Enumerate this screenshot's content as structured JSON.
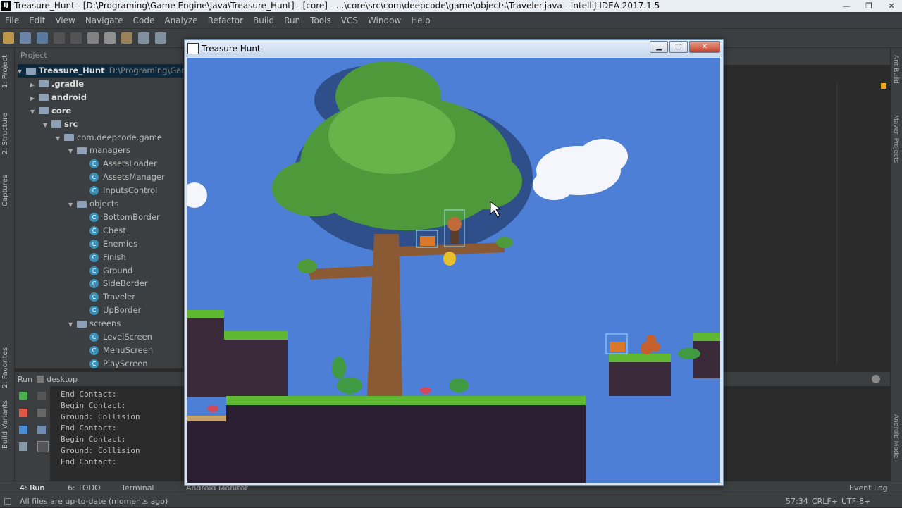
{
  "window": {
    "title": "Treasure_Hunt - [D:\\Programing\\Game Engine\\Java\\Treasure_Hunt] - [core] - ...\\core\\src\\com\\deepcode\\game\\objects\\Traveler.java - IntelliJ IDEA 2017.1.5",
    "app_icon_text": "IJ"
  },
  "menu": [
    "File",
    "Edit",
    "View",
    "Navigate",
    "Code",
    "Analyze",
    "Refactor",
    "Build",
    "Run",
    "Tools",
    "VCS",
    "Window",
    "Help"
  ],
  "toolbar": {
    "config_label": "desktop"
  },
  "left_tabs": [
    "1: Project",
    "2: Structure",
    "Captures",
    "Build Variants",
    "2: Favorites"
  ],
  "right_tabs": [
    "Ant Build",
    "Maven Projects",
    "Android Model"
  ],
  "project": {
    "header": "Project",
    "tree": [
      {
        "label": "Treasure_Hunt",
        "path": "D:\\Programing\\Game E",
        "depth": 0,
        "kind": "module",
        "open": true
      },
      {
        "label": ".gradle",
        "depth": 1,
        "kind": "folder",
        "open": false
      },
      {
        "label": "android",
        "depth": 1,
        "kind": "folder",
        "open": false
      },
      {
        "label": "core",
        "depth": 1,
        "kind": "folder",
        "open": true
      },
      {
        "label": "src",
        "depth": 2,
        "kind": "folder",
        "open": true
      },
      {
        "label": "com.deepcode.game",
        "depth": 3,
        "kind": "package",
        "open": true
      },
      {
        "label": "managers",
        "depth": 4,
        "kind": "package",
        "open": true
      },
      {
        "label": "AssetsLoader",
        "depth": 5,
        "kind": "class"
      },
      {
        "label": "AssetsManager",
        "depth": 5,
        "kind": "class"
      },
      {
        "label": "InputsControl",
        "depth": 5,
        "kind": "class"
      },
      {
        "label": "objects",
        "depth": 4,
        "kind": "package",
        "open": true
      },
      {
        "label": "BottomBorder",
        "depth": 5,
        "kind": "class"
      },
      {
        "label": "Chest",
        "depth": 5,
        "kind": "class"
      },
      {
        "label": "Enemies",
        "depth": 5,
        "kind": "class"
      },
      {
        "label": "Finish",
        "depth": 5,
        "kind": "class"
      },
      {
        "label": "Ground",
        "depth": 5,
        "kind": "class"
      },
      {
        "label": "SideBorder",
        "depth": 5,
        "kind": "class"
      },
      {
        "label": "Traveler",
        "depth": 5,
        "kind": "class"
      },
      {
        "label": "UpBorder",
        "depth": 5,
        "kind": "class"
      },
      {
        "label": "screens",
        "depth": 4,
        "kind": "package",
        "open": true
      },
      {
        "label": "LevelScreen",
        "depth": 5,
        "kind": "class"
      },
      {
        "label": "MenuScreen",
        "depth": 5,
        "kind": "class"
      },
      {
        "label": "PlayScreen",
        "depth": 5,
        "kind": "class"
      }
    ]
  },
  "run": {
    "label": "Run",
    "config": "desktop",
    "console": [
      "End Contact:",
      "Begin Contact:",
      "Ground: Collision",
      "End Contact:",
      "Begin Contact:",
      "Ground: Collision",
      "End Contact:"
    ]
  },
  "bottom_tabs": {
    "run": "4: Run",
    "todo": "6: TODO",
    "terminal": "Terminal",
    "android": "Android Monitor",
    "event_log": "Event Log"
  },
  "status": {
    "message": "All files are up-to-date (moments ago)",
    "position": "57:34",
    "line_sep": "CRLF÷",
    "encoding": "UTF-8÷"
  },
  "game": {
    "title": "Treasure Hunt"
  },
  "colors": {
    "sky": "#4d7fd6",
    "ide_bg": "#2b2b2b",
    "panel": "#3c3f41",
    "selection": "#0d293e",
    "class_icon": "#3a8fb7"
  }
}
